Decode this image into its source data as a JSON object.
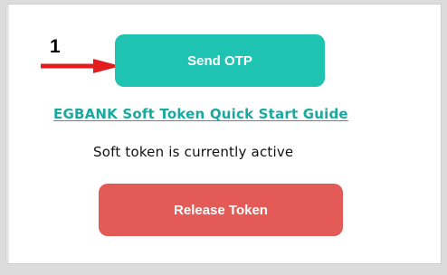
{
  "annotation": {
    "step_number": "1",
    "arrow_color": "#e31d1d"
  },
  "actions": {
    "send_otp_label": "Send OTP",
    "guide_link_text": "EGBANK Soft Token Quick Start Guide",
    "status_text": "Soft token is currently active",
    "release_token_label": "Release Token"
  },
  "colors": {
    "primary": "#1ec4b1",
    "link": "#1aa9a0",
    "danger": "#e35a57"
  }
}
